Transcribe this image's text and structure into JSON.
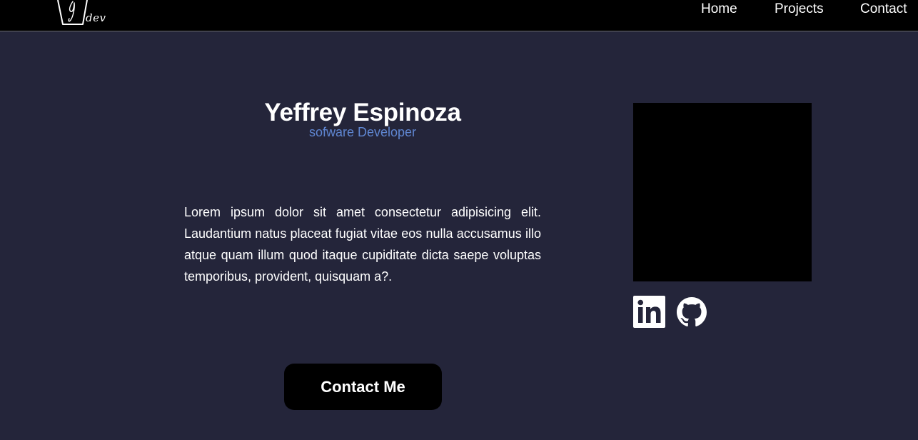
{
  "brand": {
    "logo_text": "dev",
    "logo_icon": "y-cup-logo-icon"
  },
  "nav": {
    "items": [
      {
        "label": "Home"
      },
      {
        "label": "Projects"
      },
      {
        "label": "Contact"
      }
    ]
  },
  "hero": {
    "name": "Yeffrey Espinoza",
    "role": "sofware Developer",
    "bio": "Lorem ipsum dolor sit amet consectetur adipisicing elit. Laudantium natus placeat fugiat vitae eos nulla accusamus illo atque quam illum quod itaque cupiditate dicta saepe voluptas temporibus, provident, quisquam a?.",
    "cta_label": "Contact Me"
  },
  "social": [
    {
      "icon": "linkedin-icon"
    },
    {
      "icon": "github-icon"
    }
  ],
  "colors": {
    "background": "#24253a",
    "navbar": "#000000",
    "accent": "#5f86d1",
    "button": "#000000",
    "text": "#ffffff"
  }
}
